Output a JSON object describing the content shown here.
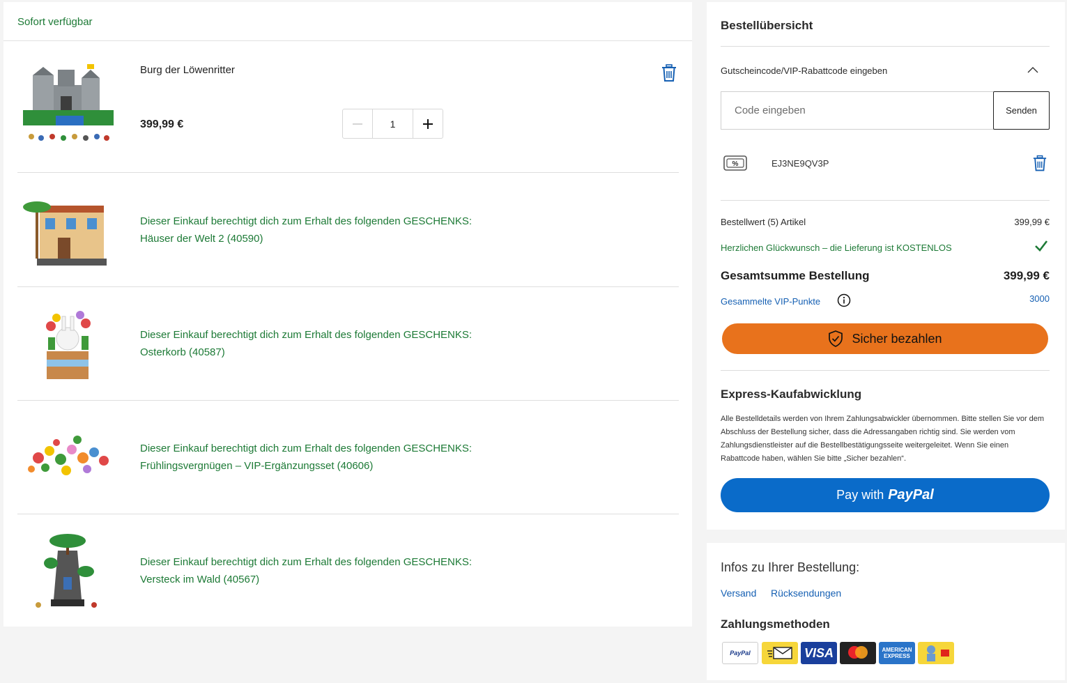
{
  "cart": {
    "availability": "Sofort verfügbar",
    "item": {
      "title": "Burg der Löwenritter",
      "price": "399,99 €",
      "quantity": "1"
    },
    "gift_prefix": "Dieser Einkauf berechtigt dich zum Erhalt des folgenden GESCHENKS:",
    "gifts": [
      {
        "name": "Häuser der Welt 2 (40590)"
      },
      {
        "name": "Osterkorb (40587)"
      },
      {
        "name": "Frühlingsvergnügen – VIP-Ergänzungsset (40606)"
      },
      {
        "name": "Versteck im Wald (40567)"
      }
    ]
  },
  "summary": {
    "title": "Bestellübersicht",
    "coupon_toggle": "Gutscheincode/VIP-Rabattcode eingeben",
    "code_placeholder": "Code eingeben",
    "send_label": "Senden",
    "applied_code": "EJ3NE9QV3P",
    "order_value_label": "Bestellwert (5) Artikel",
    "order_value": "399,99 €",
    "free_shipping": "Herzlichen Glückwunsch – die Lieferung ist KOSTENLOS",
    "total_label": "Gesamtsumme Bestellung",
    "total_value": "399,99 €",
    "vip_label": "Gesammelte VIP-Punkte",
    "vip_value": "3000",
    "pay_label": "Sicher bezahlen",
    "express_title": "Express-Kaufabwicklung",
    "express_text": "Alle Bestelldetails werden von Ihrem Zahlungsabwickler übernommen. Bitte stellen Sie vor dem Abschluss der Bestellung sicher, dass die Adressangaben richtig sind. Sie werden vom Zahlungsdienstleister auf die Bestellbestätigungsseite weitergeleitet. Wenn Sie einen Rabattcode haben, wählen Sie bitte „Sicher bezahlen“.",
    "paypal_prefix": "Pay with",
    "paypal_brand": "PayPal"
  },
  "info": {
    "title": "Infos zu Ihrer Bestellung:",
    "links": [
      "Versand",
      "Rücksendungen"
    ],
    "payment_title": "Zahlungsmethoden",
    "payment_methods": [
      "PayPal",
      "VISA",
      "AMERICAN EXPRESS"
    ]
  },
  "colors": {
    "green": "#1d7a36",
    "blue_link": "#1660b3",
    "pay_orange": "#e8721c",
    "paypal_blue": "#0a6bc9"
  }
}
